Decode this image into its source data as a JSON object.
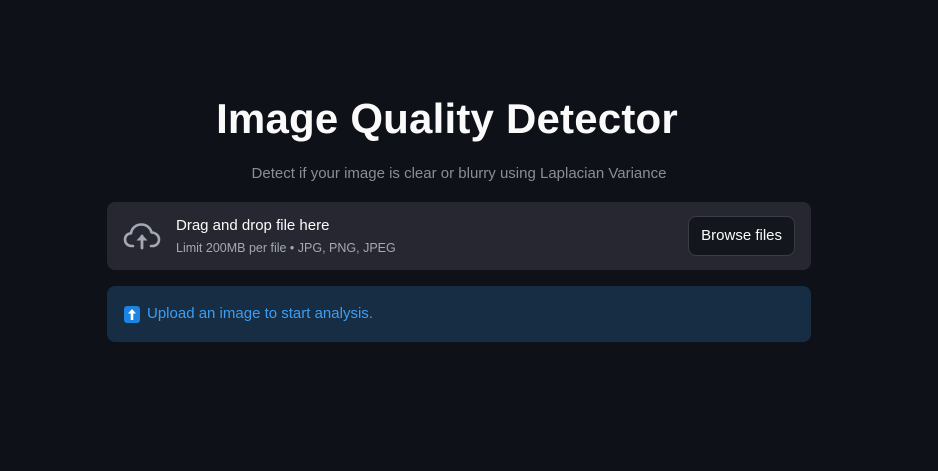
{
  "app": {
    "title": "Image Quality Detector",
    "subtitle": "Detect if your image is clear or blurry using Laplacian Variance"
  },
  "uploader": {
    "icon": "cloud-upload-icon",
    "drop_label": "Drag and drop file here",
    "limit_label": "Limit 200MB per file • JPG, PNG, JPEG",
    "browse_label": "Browse files"
  },
  "info": {
    "icon": "up-arrow-icon",
    "message": "Upload an image to start analysis."
  },
  "colors": {
    "background": "#0e1117",
    "uploader_bg": "#262730",
    "info_bg": "#172d43",
    "info_text": "#3d9df3",
    "info_icon": "#1c83e1"
  }
}
